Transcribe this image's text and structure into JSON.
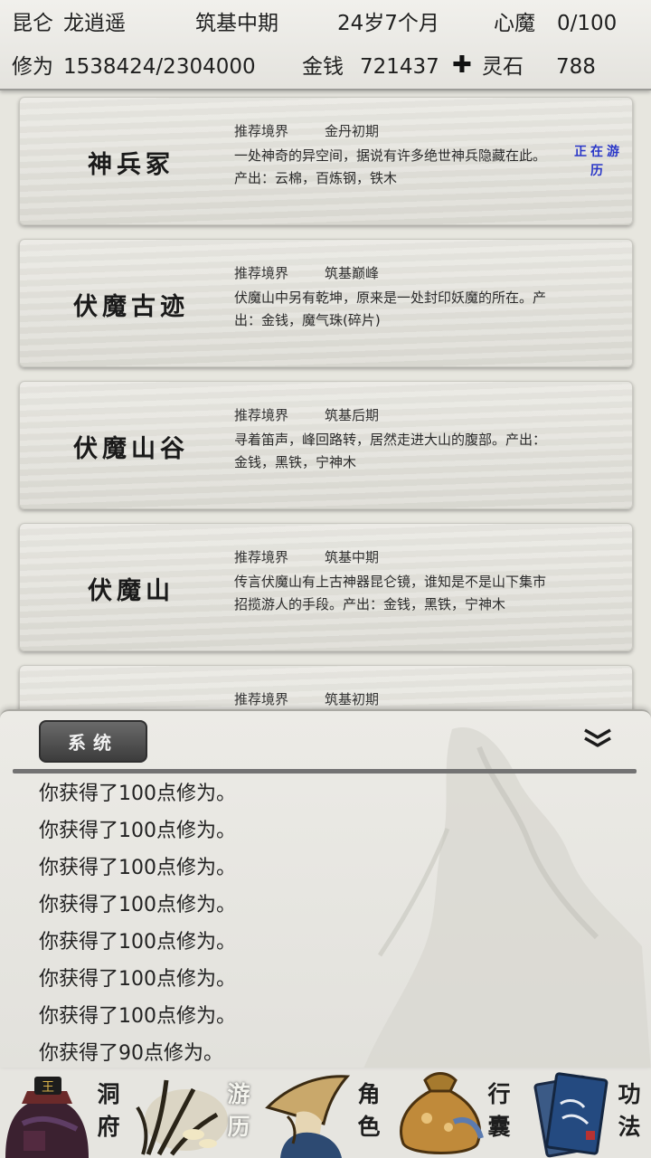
{
  "status": {
    "location": "昆仑",
    "player_name": "龙逍遥",
    "realm": "筑基中期",
    "age": "24岁7个月",
    "xinmo_label": "心魔",
    "xinmo_value": "0/100",
    "xiuwei_label": "修为",
    "xiuwei_value": "1538424/2304000",
    "money_label": "金钱",
    "money_value": "721437",
    "lingshi_icon": "spirit-stone-icon",
    "lingshi_label": "灵石",
    "lingshi_value": "788"
  },
  "adventures": [
    {
      "name": "神兵冢",
      "realm_label": "推荐境界",
      "realm": "金丹初期",
      "desc": "一处神奇的异空间，据说有许多绝世神兵隐藏在此。产出：云棉，百炼钢，铁木",
      "status": "正在游历"
    },
    {
      "name": "伏魔古迹",
      "realm_label": "推荐境界",
      "realm": "筑基巅峰",
      "desc": "伏魔山中另有乾坤，原来是一处封印妖魔的所在。产出：金钱，魔气珠(碎片)"
    },
    {
      "name": "伏魔山谷",
      "realm_label": "推荐境界",
      "realm": "筑基后期",
      "desc": "寻着笛声，峰回路转，居然走进大山的腹部。产出：金钱，黑铁，宁神木"
    },
    {
      "name": "伏魔山",
      "realm_label": "推荐境界",
      "realm": "筑基中期",
      "desc": "传言伏魔山有上古神器昆仑镜，谁知是不是山下集市招揽游人的手段。产出：金钱，黑铁，宁神木"
    },
    {
      "name": "",
      "realm_label": "推荐境界",
      "realm": "筑基初期",
      "desc": ""
    }
  ],
  "log": {
    "tab_label": "系统",
    "collapse_icon": "double-chevron-down-icon",
    "lines": [
      "你获得了100点修为。",
      "你获得了100点修为。",
      "你获得了100点修为。",
      "你获得了100点修为。",
      "你获得了100点修为。",
      "你获得了100点修为。",
      "你获得了100点修为。",
      "你获得了90点修为。"
    ]
  },
  "nav": [
    {
      "label": "洞府",
      "icon": "cave-mansion-icon"
    },
    {
      "label": "游历",
      "icon": "travel-icon",
      "active": true
    },
    {
      "label": "角色",
      "icon": "character-icon"
    },
    {
      "label": "行囊",
      "icon": "bag-icon"
    },
    {
      "label": "功法",
      "icon": "scripture-book-icon"
    }
  ],
  "colors": {
    "status_active": "#2a37c8",
    "log_tab_bg": "#4a4a4a",
    "paper": "#e4e3dc"
  }
}
